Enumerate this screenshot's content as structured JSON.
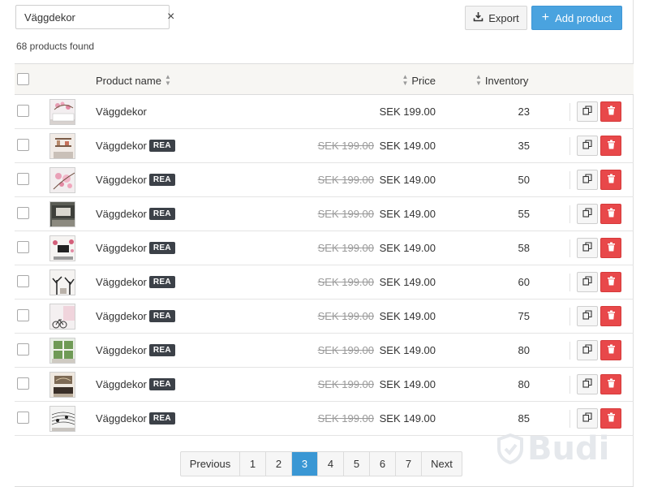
{
  "search": {
    "value": "Väggdekor",
    "clear_glyph": "×"
  },
  "results_count": "68 products found",
  "toolbar": {
    "export_label": "Export",
    "add_label": "Add product",
    "add_icon": "+"
  },
  "colors": {
    "primary": "#4aa3df",
    "danger": "#e8484a",
    "badge": "#3c4148"
  },
  "table": {
    "headers": {
      "name": "Product name",
      "price": "Price",
      "inventory": "Inventory"
    },
    "rows": [
      {
        "name": "Väggdekor",
        "badge": "",
        "old_price": "",
        "price": "SEK 199.00",
        "inventory": "23",
        "thumb": "pink-branch"
      },
      {
        "name": "Väggdekor",
        "badge": "REA",
        "old_price": "SEK 199.00",
        "price": "SEK 149.00",
        "inventory": "35",
        "thumb": "shelf"
      },
      {
        "name": "Väggdekor",
        "badge": "REA",
        "old_price": "SEK 199.00",
        "price": "SEK 149.00",
        "inventory": "50",
        "thumb": "pink-flowers"
      },
      {
        "name": "Väggdekor",
        "badge": "REA",
        "old_price": "SEK 199.00",
        "price": "SEK 149.00",
        "inventory": "55",
        "thumb": "dark-room"
      },
      {
        "name": "Väggdekor",
        "badge": "REA",
        "old_price": "SEK 199.00",
        "price": "SEK 149.00",
        "inventory": "58",
        "thumb": "tv-wall"
      },
      {
        "name": "Väggdekor",
        "badge": "REA",
        "old_price": "SEK 199.00",
        "price": "SEK 149.00",
        "inventory": "60",
        "thumb": "black-tree"
      },
      {
        "name": "Väggdekor",
        "badge": "REA",
        "old_price": "SEK 199.00",
        "price": "SEK 149.00",
        "inventory": "75",
        "thumb": "bicycle"
      },
      {
        "name": "Väggdekor",
        "badge": "REA",
        "old_price": "SEK 199.00",
        "price": "SEK 149.00",
        "inventory": "80",
        "thumb": "window-forest"
      },
      {
        "name": "Väggdekor",
        "badge": "REA",
        "old_price": "SEK 199.00",
        "price": "SEK 149.00",
        "inventory": "80",
        "thumb": "sofa"
      },
      {
        "name": "Väggdekor",
        "badge": "REA",
        "old_price": "SEK 199.00",
        "price": "SEK 149.00",
        "inventory": "85",
        "thumb": "music-notes"
      }
    ]
  },
  "pagination": {
    "previous": "Previous",
    "next": "Next",
    "pages": [
      "1",
      "2",
      "3",
      "4",
      "5",
      "6",
      "7"
    ],
    "current": "3"
  },
  "watermark": "Budi"
}
